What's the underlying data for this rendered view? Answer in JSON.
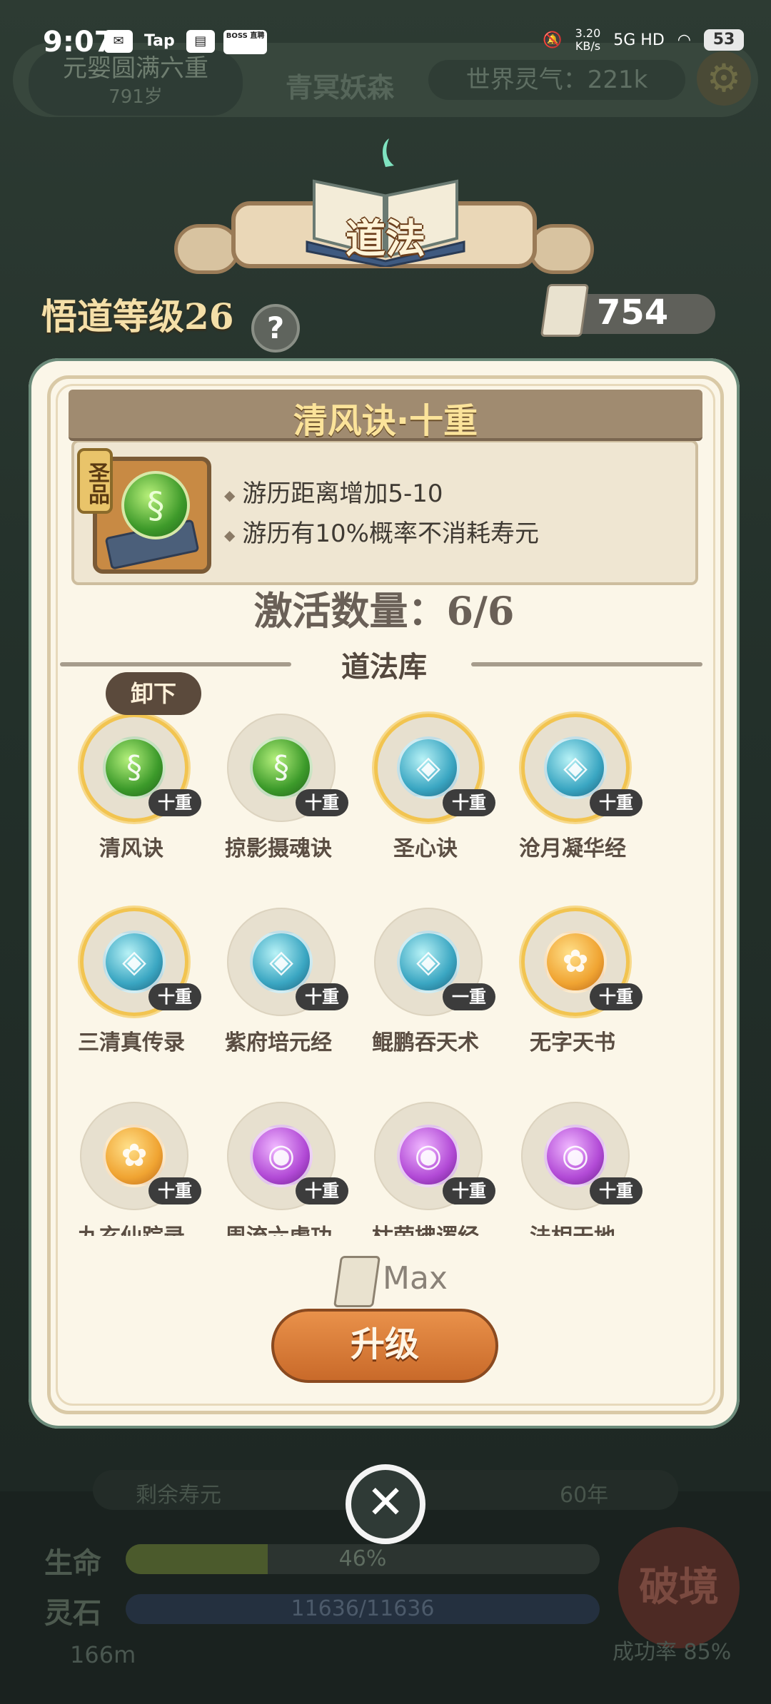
{
  "status_bar": {
    "time": "9:07",
    "apps": [
      "Tap",
      "BOSS 直聘"
    ],
    "speed": "3.20\nKB/s",
    "network": "5G HD",
    "battery": "53"
  },
  "background": {
    "realm": "元婴圆满六重",
    "age": "791岁",
    "zone": "青冥妖森",
    "world_qi": "世界灵气：221k",
    "remain_label": "剩余寿元",
    "remain_years": "60年",
    "life_label": "生命",
    "life_value": "46%",
    "life_fraction": 0.3,
    "stone_label": "灵石",
    "stone_value": "11636/11636",
    "distance": "166m",
    "breakthrough": "破境",
    "success_rate": "成功率 85%"
  },
  "header": {
    "title": "道法",
    "wudao_level": "悟道等级26",
    "help": "?",
    "scroll_count": "754"
  },
  "detail": {
    "title": "清风诀·十重",
    "grade": "圣品",
    "effects": [
      "游历距离增加5-10",
      "游历有10%概率不消耗寿元"
    ]
  },
  "active_count": "激活数量：6/6",
  "library_title": "道法库",
  "unequip_label": "卸下",
  "skills": [
    {
      "name": "清风诀",
      "tier": "十重",
      "color": "green",
      "equipped": true
    },
    {
      "name": "掠影摄魂诀",
      "tier": "十重",
      "color": "green",
      "equipped": false
    },
    {
      "name": "圣心诀",
      "tier": "十重",
      "color": "cyan",
      "equipped": true
    },
    {
      "name": "沧月凝华经",
      "tier": "十重",
      "color": "cyan",
      "equipped": true
    },
    {
      "name": "三清真传录",
      "tier": "十重",
      "color": "cyan",
      "equipped": true
    },
    {
      "name": "紫府培元经",
      "tier": "十重",
      "color": "cyan",
      "equipped": false
    },
    {
      "name": "鲲鹏吞天术",
      "tier": "一重",
      "color": "cyan",
      "equipped": false
    },
    {
      "name": "无字天书",
      "tier": "十重",
      "color": "gold",
      "equipped": true
    },
    {
      "name": "九玄仙踪录",
      "tier": "十重",
      "color": "gold",
      "equipped": false
    },
    {
      "name": "周流六虚功",
      "tier": "十重",
      "color": "purple",
      "equipped": false
    },
    {
      "name": "枯荣拂逻经",
      "tier": "十重",
      "color": "purple",
      "equipped": false
    },
    {
      "name": "法相天地",
      "tier": "十重",
      "color": "purple",
      "equipped": false
    }
  ],
  "max_label": "Max",
  "upgrade_label": "升级",
  "close_label": "✕",
  "icons": {
    "gear": "⚙",
    "close": "✕"
  }
}
